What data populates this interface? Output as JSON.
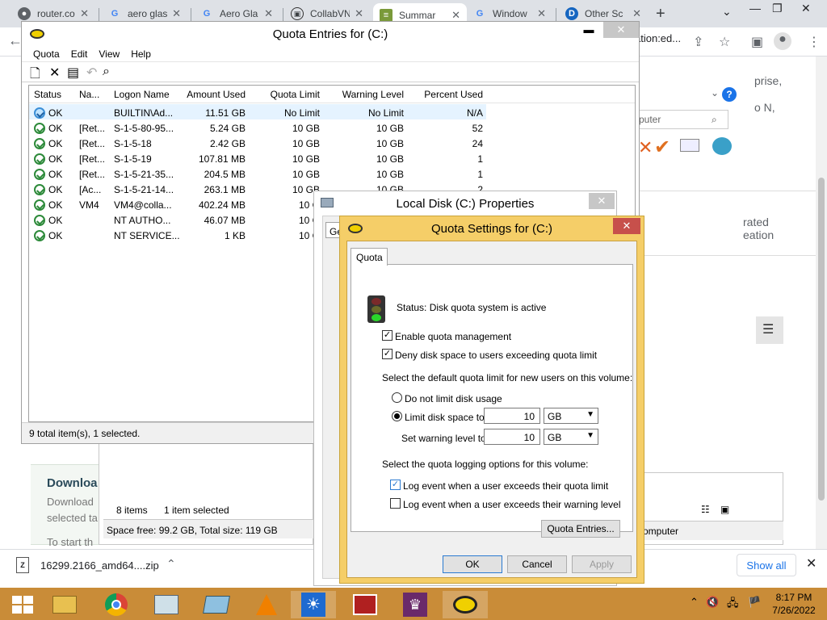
{
  "browser": {
    "tabs": [
      {
        "label": "router.co",
        "icon": "globe-icon",
        "active": false
      },
      {
        "label": "aero glas",
        "icon": "google-icon",
        "active": false
      },
      {
        "label": "Aero Gla",
        "icon": "google-icon",
        "active": false
      },
      {
        "label": "CollabVN",
        "icon": "collabvm-icon",
        "active": false
      },
      {
        "label": "Summar",
        "icon": "summary-icon",
        "active": true
      },
      {
        "label": "Window",
        "icon": "google-icon",
        "active": false
      },
      {
        "label": "Other Sc",
        "icon": "other-icon",
        "active": false
      }
    ],
    "omnibox_tail": "ation:ed...",
    "right_texts": [
      "prise,",
      "o N,",
      "rated",
      "eation"
    ],
    "search_placeholder": "puter",
    "computer_label": "omputer",
    "download_title": "Downloa",
    "download_sub1": "Download",
    "download_sub2": "selected ta",
    "download_sub3": "To start th",
    "download_bar": {
      "file": "16299.2166_amd64....zip",
      "show_all": "Show all"
    }
  },
  "quota_entries": {
    "title": "Quota Entries for  (C:)",
    "menu": [
      "Quota",
      "Edit",
      "View",
      "Help"
    ],
    "columns": [
      "Status",
      "Na...",
      "Logon Name",
      "Amount Used",
      "Quota Limit",
      "Warning Level",
      "Percent Used"
    ],
    "rows": [
      {
        "status": "OK",
        "name": "",
        "logon": "BUILTIN\\Ad...",
        "used": "11.51 GB",
        "limit": "No Limit",
        "warning": "No Limit",
        "percent": "N/A",
        "selected": true,
        "icon": "blue"
      },
      {
        "status": "OK",
        "name": "[Ret...",
        "logon": "S-1-5-80-95...",
        "used": "5.24 GB",
        "limit": "10 GB",
        "warning": "10 GB",
        "percent": "52"
      },
      {
        "status": "OK",
        "name": "[Ret...",
        "logon": "S-1-5-18",
        "used": "2.42 GB",
        "limit": "10 GB",
        "warning": "10 GB",
        "percent": "24"
      },
      {
        "status": "OK",
        "name": "[Ret...",
        "logon": "S-1-5-19",
        "used": "107.81 MB",
        "limit": "10 GB",
        "warning": "10 GB",
        "percent": "1"
      },
      {
        "status": "OK",
        "name": "[Ret...",
        "logon": "S-1-5-21-35...",
        "used": "204.5 MB",
        "limit": "10 GB",
        "warning": "10 GB",
        "percent": "1"
      },
      {
        "status": "OK",
        "name": "[Ac...",
        "logon": "S-1-5-21-14...",
        "used": "263.1 MB",
        "limit": "10 GB",
        "warning": "10 GB",
        "percent": "2"
      },
      {
        "status": "OK",
        "name": "VM4",
        "logon": "VM4@colla...",
        "used": "402.24 MB",
        "limit": "10 G",
        "warning": "",
        "percent": ""
      },
      {
        "status": "OK",
        "name": "",
        "logon": "NT AUTHO...",
        "used": "46.07 MB",
        "limit": "10 G",
        "warning": "",
        "percent": ""
      },
      {
        "status": "OK",
        "name": "",
        "logon": "NT SERVICE...",
        "used": "1 KB",
        "limit": "10 G",
        "warning": "",
        "percent": ""
      }
    ],
    "status_bar": "9 total item(s), 1 selected."
  },
  "explorer": {
    "items": "8 items",
    "selected": "1 item selected",
    "space": "Space free: 99.2 GB, Total size: 119 GB"
  },
  "local_disk": {
    "title": "Local Disk (C:) Properties",
    "tab": "Ge"
  },
  "quota_settings": {
    "title": "Quota Settings for  (C:)",
    "tab": "Quota",
    "status": "Status:  Disk quota system is active",
    "enable": "Enable quota management",
    "deny": "Deny disk space to users exceeding quota limit",
    "default_heading": "Select the default quota limit for new users on this volume:",
    "no_limit": "Do not limit disk usage",
    "limit_to": "Limit disk space to",
    "limit_value": "10",
    "limit_unit": "GB",
    "warn_to": "Set warning level to",
    "warn_value": "10",
    "warn_unit": "GB",
    "logging_heading": "Select the quota logging options for this volume:",
    "log_limit": "Log event when a user exceeds their quota limit",
    "log_warn": "Log event when a user exceeds their warning level",
    "entries_btn": "Quota Entries...",
    "ok": "OK",
    "cancel": "Cancel",
    "apply": "Apply"
  },
  "taskbar": {
    "time": "8:17 PM",
    "date": "7/26/2022"
  },
  "colors": {
    "taskbar": "#c98c38",
    "dialog_frame": "#f5ce68",
    "close_red": "#c7504b",
    "link_blue": "#1a73e8"
  }
}
